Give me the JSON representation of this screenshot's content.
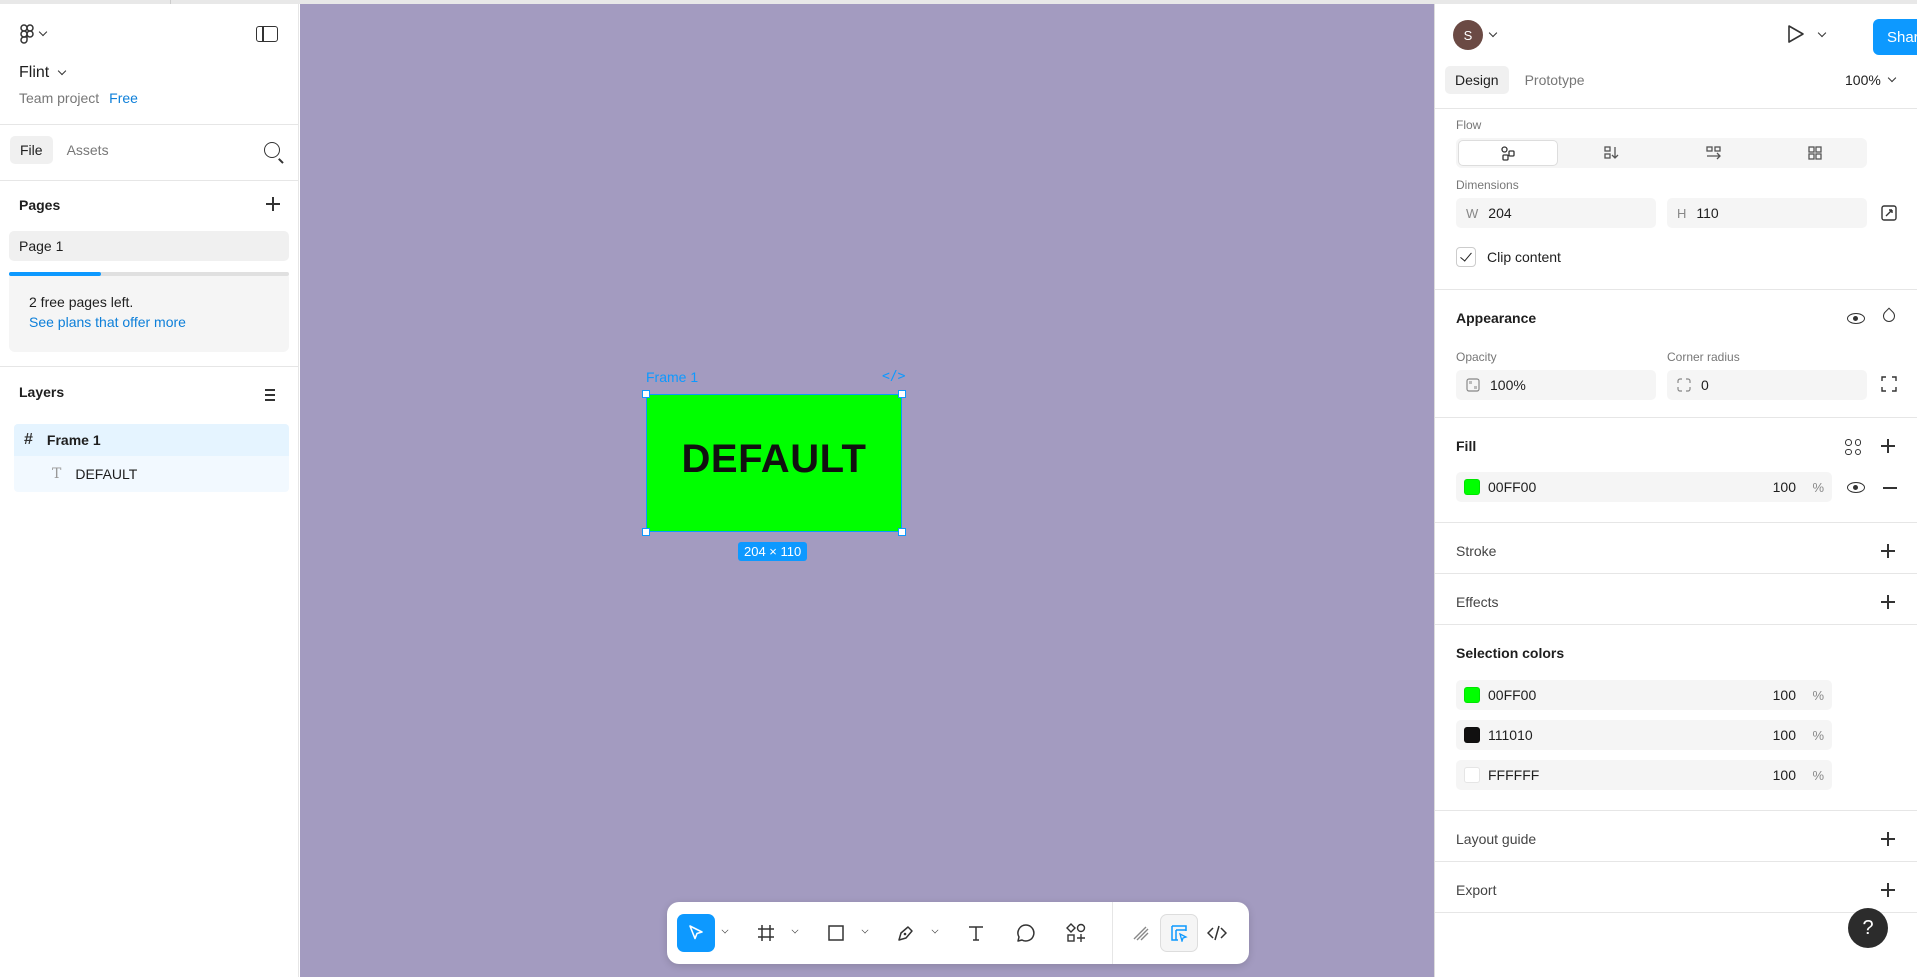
{
  "project": {
    "name": "Flint",
    "team": "Team project",
    "plan": "Free"
  },
  "left_tabs": {
    "file": "File",
    "assets": "Assets"
  },
  "pages": {
    "title": "Pages",
    "items": [
      "Page 1"
    ],
    "free_notice": "2 free pages left.",
    "plans_link": "See plans that offer more",
    "progress": 0.33
  },
  "layers": {
    "title": "Layers",
    "frame": "Frame 1",
    "text_layer": "DEFAULT"
  },
  "canvas": {
    "bg_color": "#A39BC0",
    "frame_label": "Frame 1",
    "code_label": "</>",
    "frame_text": "DEFAULT",
    "size_badge": "204 × 110"
  },
  "header": {
    "avatar": "S",
    "share": "Share"
  },
  "right_tabs": {
    "design": "Design",
    "prototype": "Prototype",
    "zoom": "100%"
  },
  "layout": {
    "flow_label": "Flow",
    "dimensions_label": "Dimensions",
    "w_label": "W",
    "w_value": "204",
    "h_label": "H",
    "h_value": "110",
    "clip_label": "Clip content"
  },
  "appearance": {
    "title": "Appearance",
    "opacity_label": "Opacity",
    "opacity_value": "100%",
    "radius_label": "Corner radius",
    "radius_value": "0"
  },
  "fill": {
    "title": "Fill",
    "hex": "00FF00",
    "color": "#00FF00",
    "opacity": "100",
    "pct": "%"
  },
  "sections": {
    "stroke": "Stroke",
    "effects": "Effects",
    "selection_colors": "Selection colors",
    "layout_guide": "Layout guide",
    "export": "Export"
  },
  "selection_colors": [
    {
      "hex": "00FF00",
      "color": "#00FF00",
      "opacity": "100",
      "pct": "%"
    },
    {
      "hex": "111010",
      "color": "#111010",
      "opacity": "100",
      "pct": "%"
    },
    {
      "hex": "FFFFFF",
      "color": "#FFFFFF",
      "opacity": "100",
      "pct": "%"
    }
  ],
  "help": "?"
}
